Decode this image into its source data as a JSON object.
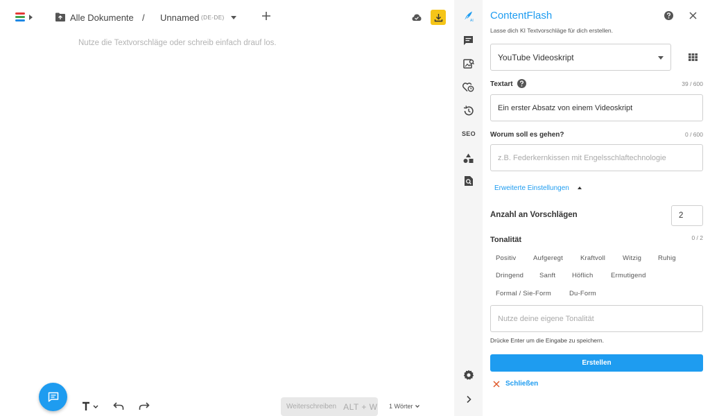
{
  "breadcrumb": {
    "all_documents": "Alle Dokumente",
    "separator": "/",
    "document_name": "Unnamed",
    "language": "(DE-DE)"
  },
  "editor": {
    "placeholder": "Nutze die Textvorschläge oder schreib einfach drauf los."
  },
  "bottombar": {
    "continue_label": "Weiterschreiben",
    "continue_shortcut": "ALT + W",
    "word_count": "1 Wörter"
  },
  "rail": {
    "seo_label": "SEO"
  },
  "panel": {
    "title": "ContentFlash",
    "subtitle": "Lasse dich KI Textvorschläge für dich erstellen.",
    "template": "YouTube Videoskript",
    "textart_label": "Textart",
    "textart_counter": "39 / 600",
    "textart_value": "Ein erster Absatz von einem Videoskript",
    "topic_label": "Worum soll es gehen?",
    "topic_counter": "0 / 600",
    "topic_placeholder": "z.B. Federkernkissen mit Engelsschlaftechnologie",
    "advanced_label": "Erweiterte Einstellungen",
    "count_label": "Anzahl an Vorschlägen",
    "count_value": "2",
    "tone_label": "Tonalität",
    "tone_counter": "0 / 2",
    "tones": [
      "Positiv",
      "Aufgeregt",
      "Kraftvoll",
      "Witzig",
      "Ruhig",
      "Dringend",
      "Sanft",
      "Höflich",
      "Ermutigend",
      "Formal / Sie-Form",
      "Du-Form"
    ],
    "own_tone_placeholder": "Nutze deine eigene Tonalität",
    "hint": "Drücke Enter um die Eingabe zu speichern.",
    "create_label": "Erstellen",
    "close_label": "Schließen"
  },
  "colors": {
    "accent": "#1e9cf0",
    "download": "#f5c518"
  }
}
